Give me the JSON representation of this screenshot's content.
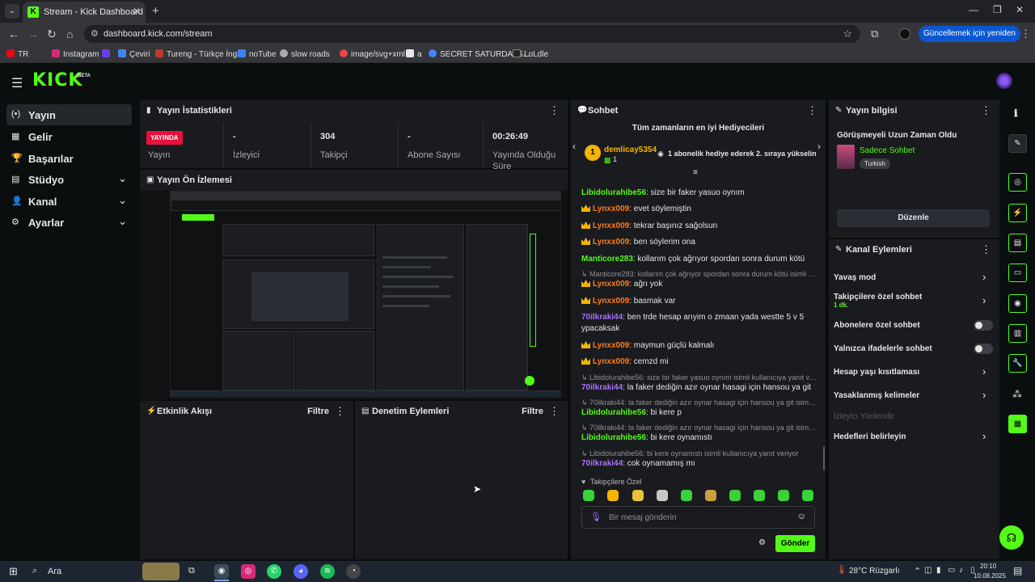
{
  "browser": {
    "tab_title": "Stream - Kick Dashboard",
    "url": "dashboard.kick.com/stream",
    "update_label": "Güncellemek için yeniden başlat",
    "bookmarks": [
      "TR",
      "Instagram",
      "Çeviri",
      "Tureng - Türkçe İngi...",
      "noTube",
      "slow roads",
      "image/svg+xml",
      "a",
      "SECRET SATURDAYS...",
      "LoLdle"
    ]
  },
  "header": {
    "logo": "KICK",
    "beta": "BETA"
  },
  "sidebar": {
    "items": [
      {
        "label": "Yayın",
        "icon": "(•)"
      },
      {
        "label": "Gelir",
        "icon": "▦"
      },
      {
        "label": "Başarılar",
        "icon": "🏆"
      },
      {
        "label": "Stüdyo",
        "icon": "▤"
      },
      {
        "label": "Kanal",
        "icon": "👤"
      },
      {
        "label": "Ayarlar",
        "icon": "⚙"
      }
    ]
  },
  "stats": {
    "title": "Yayın İstatistikleri",
    "live_badge": "YAYINDA",
    "items": [
      {
        "value": "",
        "label": "Yayın"
      },
      {
        "value": "-",
        "label": "İzleyici"
      },
      {
        "value": "304",
        "label": "Takipçi"
      },
      {
        "value": "-",
        "label": "Abone Sayısı"
      },
      {
        "value": "00:26:49",
        "label": "Yayında Olduğu Süre"
      }
    ]
  },
  "preview": {
    "title": "Yayın Ön İzlemesi"
  },
  "activity": {
    "title": "Etkinlik Akışı",
    "filter": "Filtre"
  },
  "moderation": {
    "title": "Denetim Eylemleri",
    "filter": "Filtre"
  },
  "chat": {
    "title": "Sohbet",
    "gifters_title": "Tüm zamanların en iyi Hediyecileri",
    "gifter": {
      "rank": "1",
      "name": "demlicay5354",
      "count": "1",
      "message": "1 abonelik hediye ederek 2. sıraya yükselin"
    },
    "messages": [
      {
        "type": "msg",
        "user": "Libidolurahibe56",
        "color": "green",
        "crown": false,
        "text": ": size bir faker yasuo oynım"
      },
      {
        "type": "msg",
        "user": "Lynxx009",
        "color": "orange",
        "crown": true,
        "text": ": evet söylemiştin"
      },
      {
        "type": "msg",
        "user": "Lynxx009",
        "color": "orange",
        "crown": true,
        "text": ": tekrar başınız sağolsun"
      },
      {
        "type": "msg",
        "user": "Lynxx009",
        "color": "orange",
        "crown": true,
        "text": ": ben söylerim ona"
      },
      {
        "type": "msg",
        "user": "Manticore283",
        "color": "green",
        "crown": false,
        "text": ": kollarım çok ağrıyor spordan sonra durum kötü"
      },
      {
        "type": "reply",
        "text": "↳ Manticore283: kollarım çok ağrıyor spordan sonra durum kötü isimli ku..."
      },
      {
        "type": "msg",
        "user": "Lynxx009",
        "color": "orange",
        "crown": true,
        "text": ": ağrı yok"
      },
      {
        "type": "msg",
        "user": "Lynxx009",
        "color": "orange",
        "crown": true,
        "text": ": basmak var"
      },
      {
        "type": "msg",
        "user": "70ilkraki44",
        "color": "purple",
        "crown": false,
        "text": ": ben trde hesap arıyim o zmaan yada westte 5 v 5"
      },
      {
        "type": "cont",
        "text": "ypacaksak"
      },
      {
        "type": "msg",
        "user": "Lynxx009",
        "color": "orange",
        "crown": true,
        "text": ": maymun güçlü kalmalı"
      },
      {
        "type": "msg",
        "user": "Lynxx009",
        "color": "orange",
        "crown": true,
        "text": ": cemzd mi"
      },
      {
        "type": "reply",
        "text": "↳ Libidolurahibe56: size bir faker yasuo oynım isimli kullanıcıya yanıt ver..."
      },
      {
        "type": "msg",
        "user": "70ilkraki44",
        "color": "purple",
        "crown": false,
        "text": ": la faker dediğin azır oynar hasagi için hansou ya git"
      },
      {
        "type": "reply",
        "text": "↳ 70ilkraki44: la faker dediğin azır oynar hasagi için hansou ya git isimli ..."
      },
      {
        "type": "msg",
        "user": "Libidolurahibe56",
        "color": "green",
        "crown": false,
        "text": ": bi kere p"
      },
      {
        "type": "reply",
        "text": "↳ 70ilkraki44: la faker dediğin azır oynar hasagi için hansou ya git isimli ..."
      },
      {
        "type": "msg",
        "user": "Libidolurahibe56",
        "color": "green",
        "crown": false,
        "text": ": bi kere oynamıstı"
      },
      {
        "type": "reply",
        "text": "↳ Libidolurahibe56: bi kere oynamıstı isimli kullanıcıya yanıt veriyor"
      },
      {
        "type": "msg",
        "user": "70ilkraki44",
        "color": "purple",
        "crown": false,
        "text": ": cok oynamamış mı"
      }
    ],
    "emotes_label": "Takipçilere Özel",
    "input_placeholder": "Bir mesaj gönderin",
    "send_label": "Gönder"
  },
  "stream_info": {
    "title": "Yayın bilgisi",
    "stream_title": "Görüşmeyeli Uzun Zaman Oldu",
    "category": "Sadece Sohbet",
    "tag": "Turkish",
    "edit_label": "Düzenle"
  },
  "channel_actions": {
    "title": "Kanal Eylemleri",
    "items": [
      {
        "label": "Yavaş mod",
        "control": "chevron"
      },
      {
        "label": "Takipçilere özel sohbet",
        "sub": "1 dk.",
        "control": "chevron"
      },
      {
        "label": "Abonelere özel sohbet",
        "control": "toggle"
      },
      {
        "label": "Yalnızca ifadelerle sohbet",
        "control": "toggle"
      },
      {
        "label": "Hesap yaşı kısıtlaması",
        "control": "chevron"
      },
      {
        "label": "Yasaklanmış kelimeler",
        "control": "chevron"
      },
      {
        "label": "İzleyici Yönlendir",
        "control": "none",
        "disabled": true
      },
      {
        "label": "Hedefleri belirleyin",
        "control": "chevron"
      }
    ]
  },
  "taskbar": {
    "search_label": "Ara",
    "weather": "28°C Rüzgarlı",
    "time": "20:10",
    "date": "10.08.2025"
  },
  "colors": {
    "accent": "#53fc18",
    "live": "#e9113c",
    "panel": "#191b1f",
    "bg": "#0b0e0f"
  }
}
